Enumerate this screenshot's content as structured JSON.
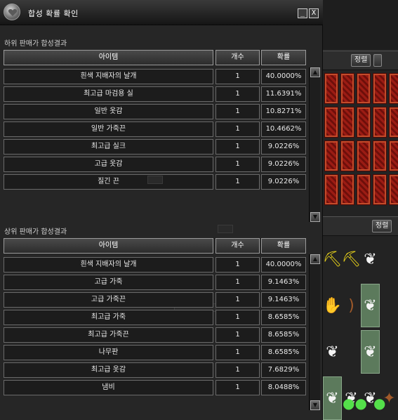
{
  "window": {
    "title": "합성 확률 확인",
    "minimize_label": "_",
    "close_label": "X"
  },
  "columns": {
    "item": "아이템",
    "count": "개수",
    "probability": "확률"
  },
  "lower_seller": {
    "title": "하위 판매가 합성결과",
    "rows": [
      {
        "item": "흰색 지배자의 날개",
        "count": "1",
        "probability": "40.0000%"
      },
      {
        "item": "최고급 마검용 실",
        "count": "1",
        "probability": "11.6391%"
      },
      {
        "item": "일반 옷감",
        "count": "1",
        "probability": "10.8271%"
      },
      {
        "item": "일반 가죽끈",
        "count": "1",
        "probability": "10.4662%"
      },
      {
        "item": "최고급 실크",
        "count": "1",
        "probability": "9.0226%"
      },
      {
        "item": "고급 옷감",
        "count": "1",
        "probability": "9.0226%"
      },
      {
        "item": "질긴 끈",
        "count": "1",
        "probability": "9.0226%"
      }
    ]
  },
  "upper_seller": {
    "title": "상위 판매가 합성결과",
    "rows": [
      {
        "item": "흰색 지배자의 날개",
        "count": "1",
        "probability": "40.0000%"
      },
      {
        "item": "고급 가죽",
        "count": "1",
        "probability": "9.1463%"
      },
      {
        "item": "고급 가죽끈",
        "count": "1",
        "probability": "9.1463%"
      },
      {
        "item": "최고급 가죽",
        "count": "1",
        "probability": "8.6585%"
      },
      {
        "item": "최고급 가죽끈",
        "count": "1",
        "probability": "8.6585%"
      },
      {
        "item": "나무판",
        "count": "1",
        "probability": "8.6585%"
      },
      {
        "item": "최고급 옷감",
        "count": "1",
        "probability": "7.6829%"
      },
      {
        "item": "냄비",
        "count": "1",
        "probability": "8.0488%"
      }
    ]
  },
  "inventory": {
    "sort_label_1": "정렬",
    "sort_label_2": "정렬"
  },
  "colors": {
    "title_bar": "#151515",
    "cell_bg": "#1c1c1c",
    "card_red": "#9b1c14",
    "slot_green": "#5c7a5c"
  }
}
